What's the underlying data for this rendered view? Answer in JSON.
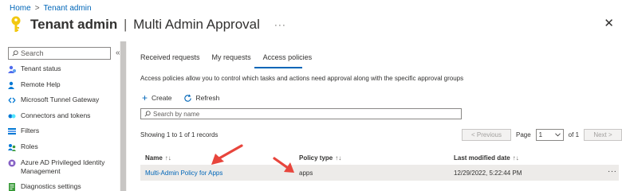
{
  "breadcrumb": {
    "home": "Home",
    "separator": ">",
    "current": "Tenant admin"
  },
  "header": {
    "title_bold": "Tenant admin",
    "title_sep": "|",
    "title_rest": "Multi Admin Approval",
    "more": "···",
    "close": "✕"
  },
  "sidebar": {
    "search_placeholder": "Search",
    "collapse": "«",
    "items": [
      {
        "label": "Tenant status",
        "icon": "tenant-status-icon",
        "color": "#4f6bed"
      },
      {
        "label": "Remote Help",
        "icon": "remote-help-icon",
        "color": "#0078d4"
      },
      {
        "label": "Microsoft Tunnel Gateway",
        "icon": "tunnel-gateway-icon",
        "color": "#0078d4"
      },
      {
        "label": "Connectors and tokens",
        "icon": "connectors-icon",
        "color": "#0078d4"
      },
      {
        "label": "Filters",
        "icon": "filters-icon",
        "color": "#0078d4"
      },
      {
        "label": "Roles",
        "icon": "roles-icon",
        "color": "#0078d4"
      },
      {
        "label": "Azure AD Privileged Identity Management",
        "icon": "pim-icon",
        "color": "#8661c5"
      },
      {
        "label": "Diagnostics settings",
        "icon": "diagnostics-icon",
        "color": "#3a9b3a"
      }
    ]
  },
  "tabs": [
    {
      "label": "Received requests",
      "active": false
    },
    {
      "label": "My requests",
      "active": false
    },
    {
      "label": "Access policies",
      "active": true
    }
  ],
  "description": "Access policies allow you to control which tasks and actions need approval along with the specific approval groups",
  "toolbar": {
    "create": "Create",
    "refresh": "Refresh"
  },
  "search": {
    "placeholder": "Search by name"
  },
  "records": "Showing 1 to 1 of 1 records",
  "pager": {
    "previous": "< Previous",
    "page_label": "Page",
    "page_value": "1",
    "of": "of 1",
    "next": "Next >"
  },
  "table": {
    "headers": {
      "name": "Name",
      "policy_type": "Policy type",
      "last_modified": "Last modified date"
    },
    "sort_name": "↑↓",
    "sort_policy": "↑↓",
    "sort_date": "↑↓",
    "rows": [
      {
        "name": "Multi-Admin Policy for Apps",
        "policy_type": "apps",
        "last_modified": "12/29/2022, 5:22:44 PM",
        "more": "···"
      }
    ]
  },
  "colors": {
    "accent": "#0066b8",
    "annotation_arrow": "#e8453c",
    "title_icon": "#f2c811"
  }
}
